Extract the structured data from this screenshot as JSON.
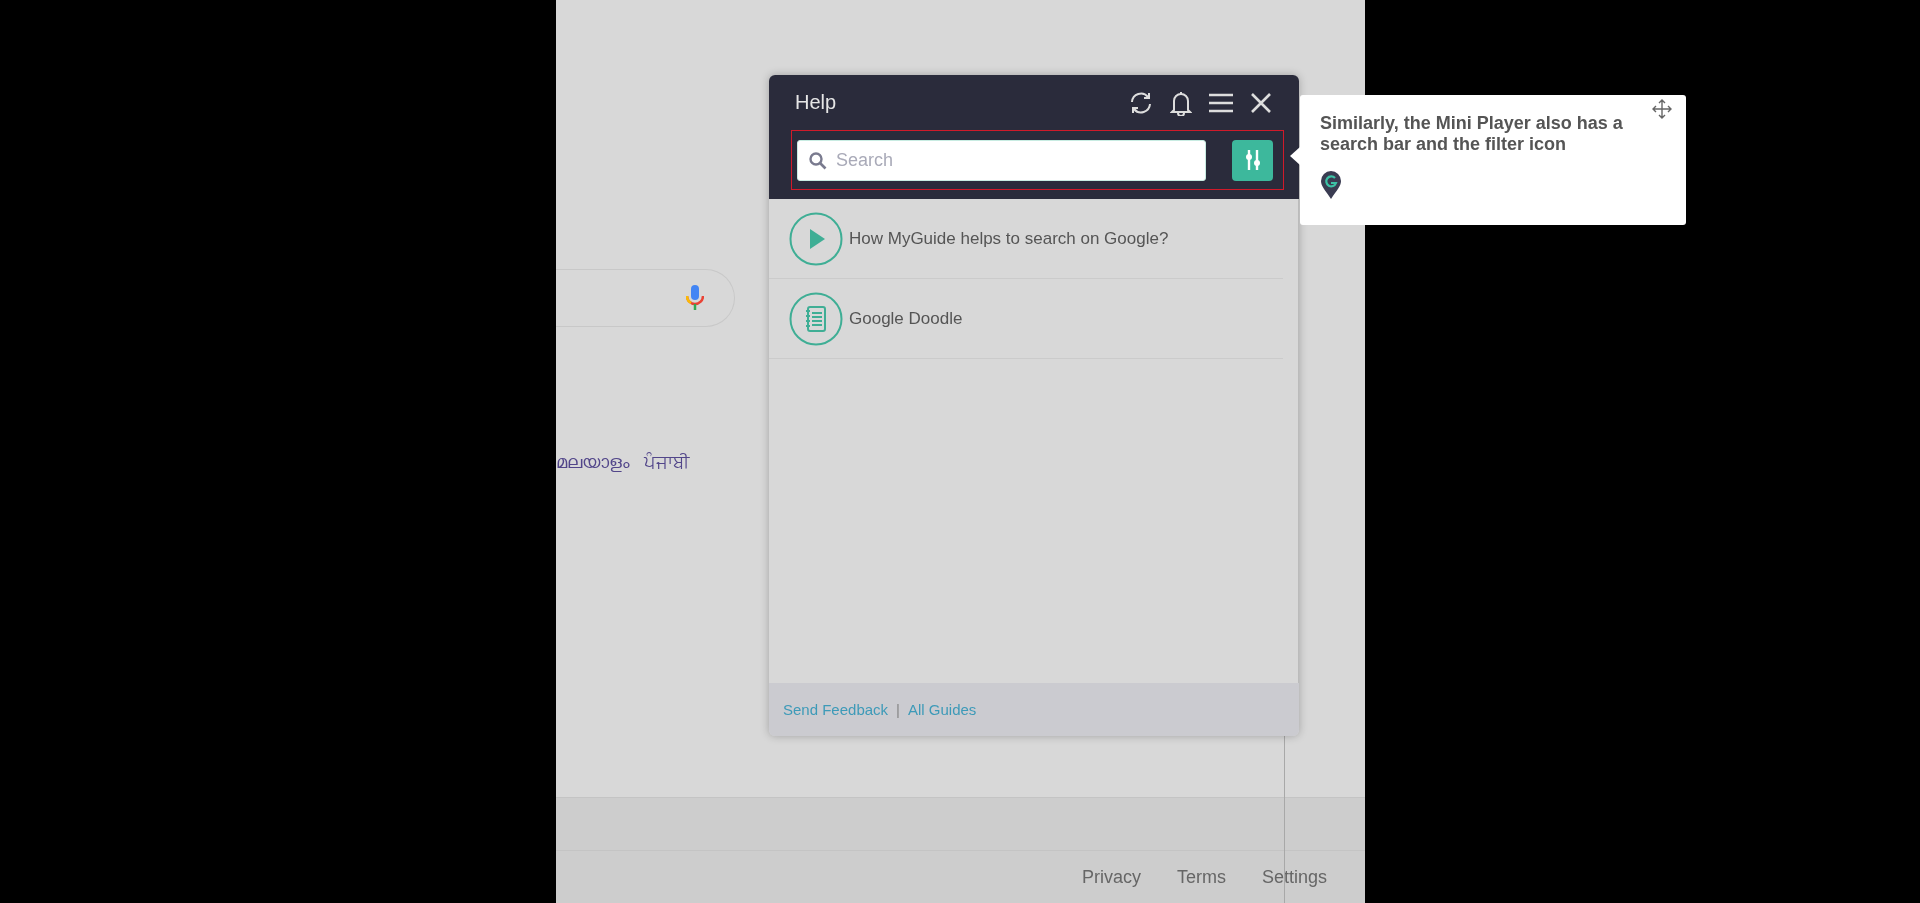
{
  "background_page": {
    "language_links": [
      "മലയാളം",
      "ਪੰਜਾਬੀ"
    ],
    "footer_links": [
      "Privacy",
      "Terms",
      "Settings"
    ]
  },
  "mini_player": {
    "title": "Help",
    "search": {
      "placeholder": "Search"
    },
    "guides": [
      {
        "kind": "video",
        "title": "How MyGuide helps to search on Google?"
      },
      {
        "kind": "document",
        "title": "Google Doodle"
      }
    ],
    "footer_links": [
      "Send Feedback",
      "All Guides"
    ],
    "footer_separator": "|"
  },
  "tooltip": {
    "text": "Similarly, the Mini Player also has a search bar and the filter icon"
  }
}
